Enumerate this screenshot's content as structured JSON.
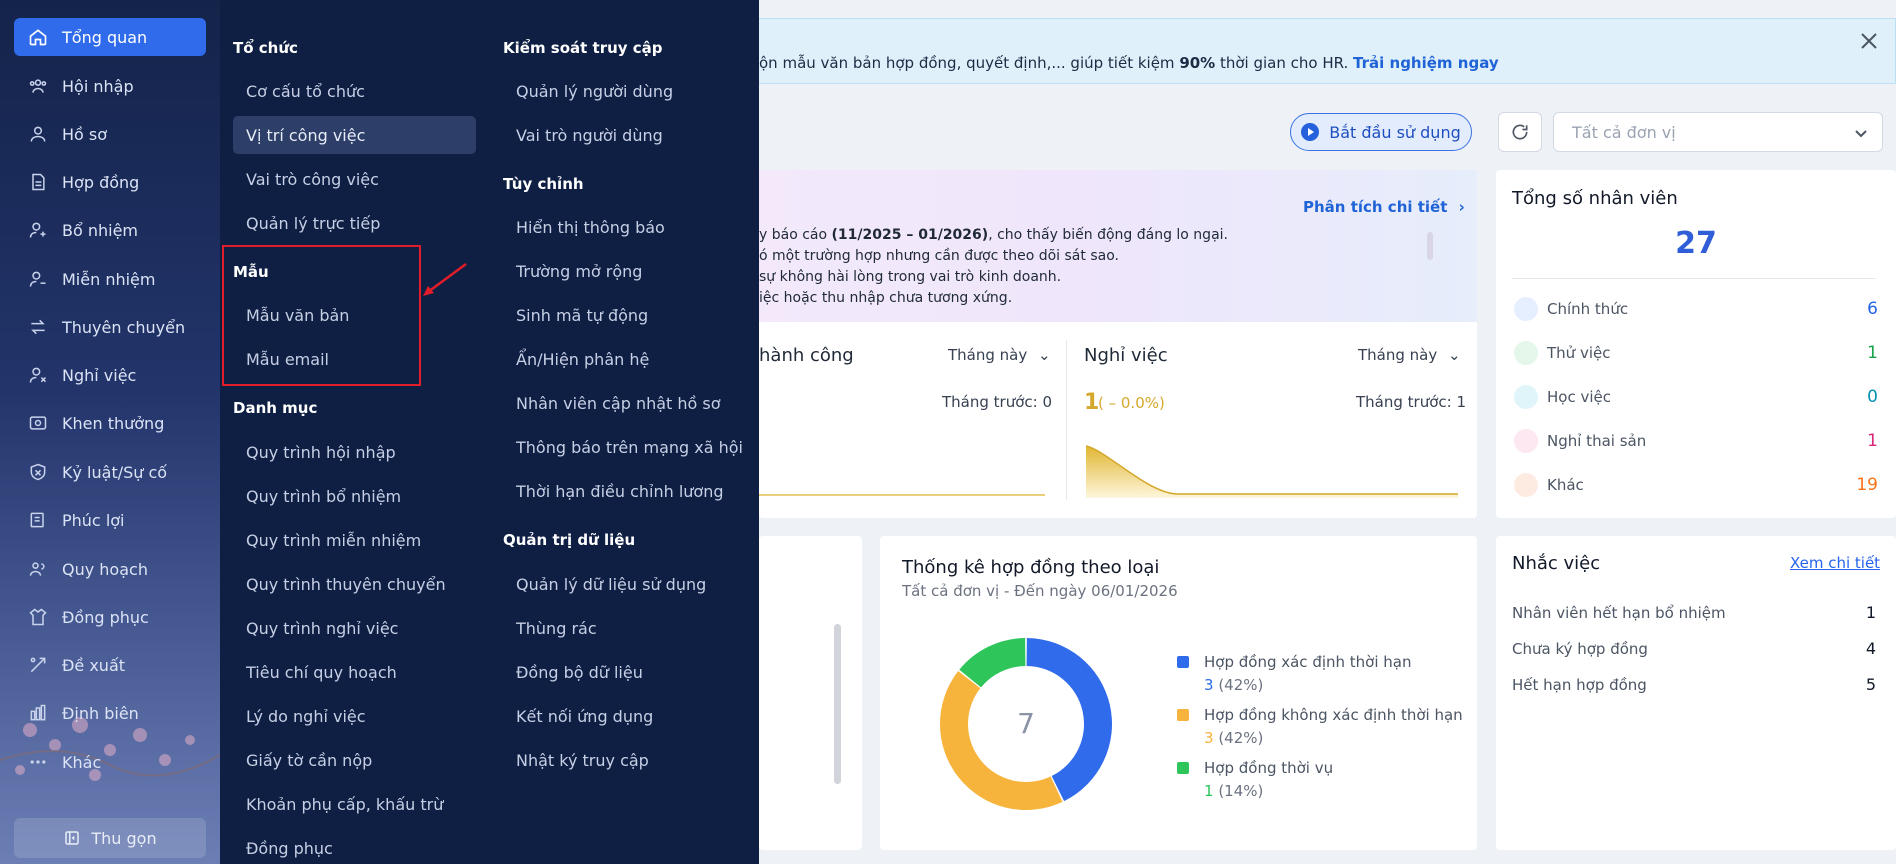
{
  "sidebar": {
    "items": [
      {
        "label": "Tổng quan",
        "icon": "home-icon"
      },
      {
        "label": "Hội nhập",
        "icon": "users-icon"
      },
      {
        "label": "Hồ sơ",
        "icon": "user-icon"
      },
      {
        "label": "Hợp đồng",
        "icon": "document-icon"
      },
      {
        "label": "Bổ nhiệm",
        "icon": "user-plus-icon"
      },
      {
        "label": "Miễn nhiệm",
        "icon": "user-minus-icon"
      },
      {
        "label": "Thuyên chuyển",
        "icon": "transfer-icon"
      },
      {
        "label": "Nghỉ việc",
        "icon": "user-x-icon"
      },
      {
        "label": "Khen thưởng",
        "icon": "award-icon"
      },
      {
        "label": "Kỷ luật/Sự cố",
        "icon": "shield-icon"
      },
      {
        "label": "Phúc lợi",
        "icon": "benefit-icon"
      },
      {
        "label": "Quy hoạch",
        "icon": "plan-icon"
      },
      {
        "label": "Đồng phục",
        "icon": "shirt-icon"
      },
      {
        "label": "Đề xuất",
        "icon": "proposal-icon"
      },
      {
        "label": "Định biên",
        "icon": "headcount-icon"
      },
      {
        "label": "Khác",
        "icon": "more-icon"
      }
    ],
    "collapse_label": "Thu gọn"
  },
  "mega_menu": {
    "col1": {
      "sections": [
        {
          "title": "Tổ chức",
          "items": [
            "Cơ cấu tổ chức",
            "Vị trí công việc",
            "Vai trò công việc",
            "Quản lý trực tiếp"
          ]
        },
        {
          "title": "Mẫu",
          "items": [
            "Mẫu văn bản",
            "Mẫu email"
          ]
        },
        {
          "title": "Danh mục",
          "items": [
            "Quy trình hội nhập",
            "Quy trình bổ nhiệm",
            "Quy trình miễn nhiệm",
            "Quy trình thuyên chuyển",
            "Quy trình nghỉ việc",
            "Tiêu chí quy hoạch",
            "Lý do nghỉ việc",
            "Giấy tờ cần nộp",
            "Khoản phụ cấp, khấu trừ",
            "Đồng phục"
          ]
        }
      ]
    },
    "col2": {
      "sections": [
        {
          "title": "Kiểm soát truy cập",
          "items": [
            "Quản lý người dùng",
            "Vai trò người dùng"
          ]
        },
        {
          "title": "Tùy chỉnh",
          "items": [
            "Hiển thị thông báo",
            "Trường mở rộng",
            "Sinh mã tự động",
            "Ẩn/Hiện phân hệ",
            "Nhân viên cập nhật hồ sơ",
            "Thông báo trên mạng xã hội",
            "Thời hạn điều chỉnh lương"
          ]
        },
        {
          "title": "Quản trị dữ liệu",
          "items": [
            "Quản lý dữ liệu sử dụng",
            "Thùng rác",
            "Đồng bộ dữ liệu",
            "Kết nối ứng dụng",
            "Nhật ký truy cập"
          ]
        }
      ]
    }
  },
  "banner": {
    "text_before": "ộn mẫu văn bản hợp đồng, quyết định,... giúp tiết kiệm ",
    "highlight": "90%",
    "text_after": " thời gian cho HR. ",
    "cta": "Trải nghiệm ngay"
  },
  "toolbar": {
    "start_label": "Bắt đầu sử dụng",
    "unit_placeholder": "Tất cả đơn vị"
  },
  "analysis": {
    "link": "Phân tích chi tiết",
    "line1_before": "y báo cáo ",
    "line1_bold": "(11/2025 – 01/2026)",
    "line1_after": ", cho thấy biến động đáng lo ngại.",
    "line2": "ó một trường hợp nhưng cần được theo dõi sát sao.",
    "line3": "sự không hài lòng trong vai trò kinh doanh.",
    "line4": "iệc hoặc thu nhập chưa tương xứng."
  },
  "kpi": {
    "left": {
      "title": "hành công",
      "filter": "Tháng này",
      "prev": "Tháng trước: 0"
    },
    "right": {
      "title": "Nghỉ việc",
      "filter": "Tháng này",
      "value": "1",
      "change": "( – 0.0%)",
      "prev": "Tháng trước: 1"
    }
  },
  "employees": {
    "title": "Tổng số nhân viên",
    "total": "27",
    "rows": [
      {
        "label": "Chính thức",
        "value": "6",
        "color": "#2563eb"
      },
      {
        "label": "Thử việc",
        "value": "1",
        "color": "#16a34a"
      },
      {
        "label": "Học việc",
        "value": "0",
        "color": "#0891b2"
      },
      {
        "label": "Nghỉ thai sản",
        "value": "1",
        "color": "#db2777"
      },
      {
        "label": "Khác",
        "value": "19",
        "color": "#f97316"
      }
    ]
  },
  "contracts": {
    "title": "Thống kê hợp đồng theo loại",
    "subtitle": "Tất cả đơn vị - Đến ngày 06/01/2026",
    "center": "7",
    "legend": [
      {
        "label": "Hợp đồng xác định thời hạn",
        "count": "3",
        "pct": "(42%)",
        "color": "#2f6bea"
      },
      {
        "label": "Hợp đồng không xác định thời hạn",
        "count": "3",
        "pct": "(42%)",
        "color": "#f6b43c"
      },
      {
        "label": "Hợp đồng thời vụ",
        "count": "1",
        "pct": "(14%)",
        "color": "#2ec55a"
      }
    ]
  },
  "chart_data": {
    "type": "pie",
    "categories": [
      "Hợp đồng xác định thời hạn",
      "Hợp đồng không xác định thời hạn",
      "Hợp đồng thời vụ"
    ],
    "values": [
      3,
      3,
      1
    ],
    "title": "Thống kê hợp đồng theo loại",
    "subtitle": "Tất cả đơn vị - Đến ngày 06/01/2026"
  },
  "reminders": {
    "title": "Nhắc việc",
    "link": "Xem chi tiết",
    "rows": [
      {
        "label": "Nhân viên hết hạn bổ nhiệm",
        "value": "1"
      },
      {
        "label": "Chưa ký hợp đồng",
        "value": "4"
      },
      {
        "label": "Hết hạn hợp đồng",
        "value": "5"
      }
    ]
  }
}
